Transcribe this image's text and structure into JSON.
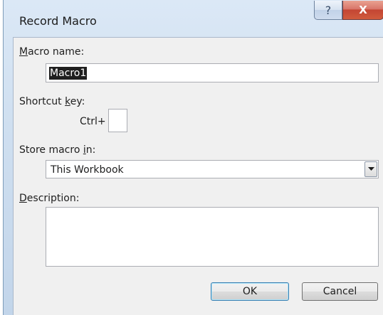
{
  "dialog": {
    "title": "Record Macro",
    "help_glyph": "?",
    "close_glyph": "X"
  },
  "macro_name": {
    "label_prefix": "",
    "label_accel": "M",
    "label_rest": "acro name:",
    "value": "Macro1"
  },
  "shortcut_key": {
    "label_prefix": "Shortcut ",
    "label_accel": "k",
    "label_rest": "ey:",
    "ctrl_label": "Ctrl+",
    "value": ""
  },
  "store_macro_in": {
    "label_prefix": "Store macro ",
    "label_accel": "i",
    "label_rest": "n:",
    "selected": "This Workbook"
  },
  "description": {
    "label_prefix": "",
    "label_accel": "D",
    "label_rest": "escription:",
    "value": ""
  },
  "buttons": {
    "ok": "OK",
    "cancel": "Cancel"
  }
}
